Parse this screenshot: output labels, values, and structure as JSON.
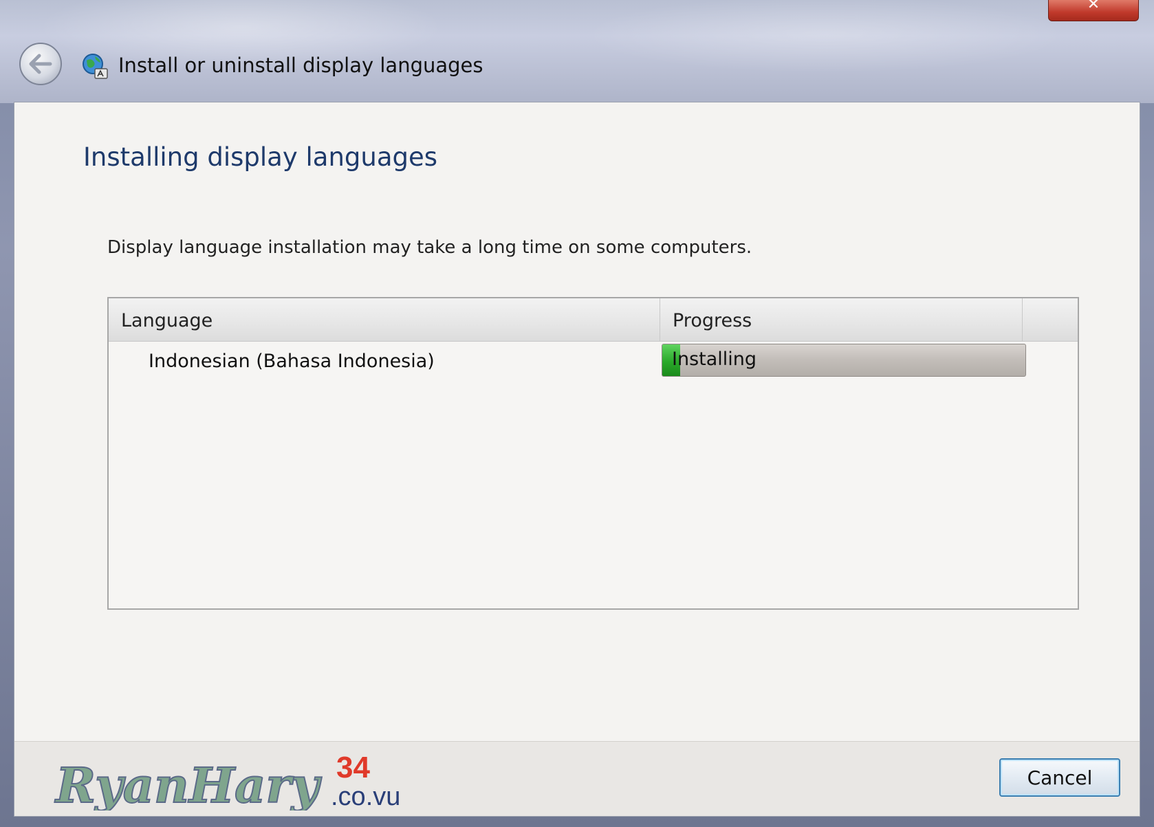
{
  "window": {
    "title": "Install or uninstall display languages",
    "close_glyph": "✕"
  },
  "page": {
    "heading": "Installing display languages",
    "description": "Display language installation may take a long time on some computers."
  },
  "table": {
    "columns": [
      "Language",
      "Progress"
    ],
    "rows": [
      {
        "language": "Indonesian (Bahasa Indonesia)",
        "status": "Installing",
        "progress_fraction": 0.05
      }
    ]
  },
  "footer": {
    "cancel_label": "Cancel",
    "watermark": {
      "name": "RyanHary",
      "number": "34",
      "domain": ".co.vu"
    }
  },
  "colors": {
    "heading": "#1e3a6b",
    "progress_fill": "#2aa92a",
    "button_border": "#3c7fb1"
  },
  "icons": [
    "back-arrow-icon",
    "globe-language-icon",
    "close-icon"
  ]
}
